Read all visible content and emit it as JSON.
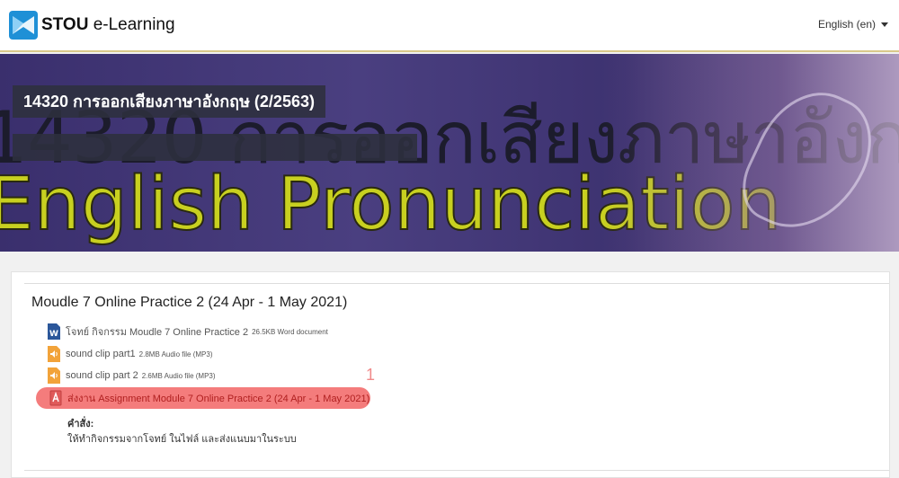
{
  "header": {
    "logo_bold": "STOU",
    "logo_rest": " e-Learning",
    "language": "English (en)"
  },
  "banner": {
    "course_title": "14320 การออกเสียงภาษาอังกฤษ (2/2563)",
    "bg_thai_text": "14320 การออกเสียงภาษาอังกฤษ",
    "bg_english_text": "English Pronunciation"
  },
  "section": {
    "title": "Moudle 7 Online Practice 2 (24 Apr - 1 May 2021)",
    "activities": [
      {
        "name": "โจทย์ กิจกรรม Moudle 7 Online Practice 2",
        "meta": "26.5KB Word document",
        "icon": "word-document-icon"
      },
      {
        "name": "sound clip part1",
        "meta": "2.8MB Audio file (MP3)",
        "icon": "audio-file-icon"
      },
      {
        "name": "sound clip part 2",
        "meta": "2.6MB Audio file (MP3)",
        "icon": "audio-file-icon"
      },
      {
        "name": "ส่งงาน Assignment Module 7 Online Practice 2 (24 Apr - 1 May 2021)",
        "meta": "",
        "icon": "assignment-icon"
      }
    ],
    "annotation_number": "1",
    "instructions_label": "คำสั่ง:",
    "instructions_text": "ให้ทำกิจกรรมจากโจทย์ ในไฟล์ และส่งแนบมาในระบบ"
  },
  "colors": {
    "highlight": "#f47c7c",
    "word_icon": "#2b579a",
    "audio_icon": "#f2a33a",
    "logo_blue": "#1e90d6"
  }
}
